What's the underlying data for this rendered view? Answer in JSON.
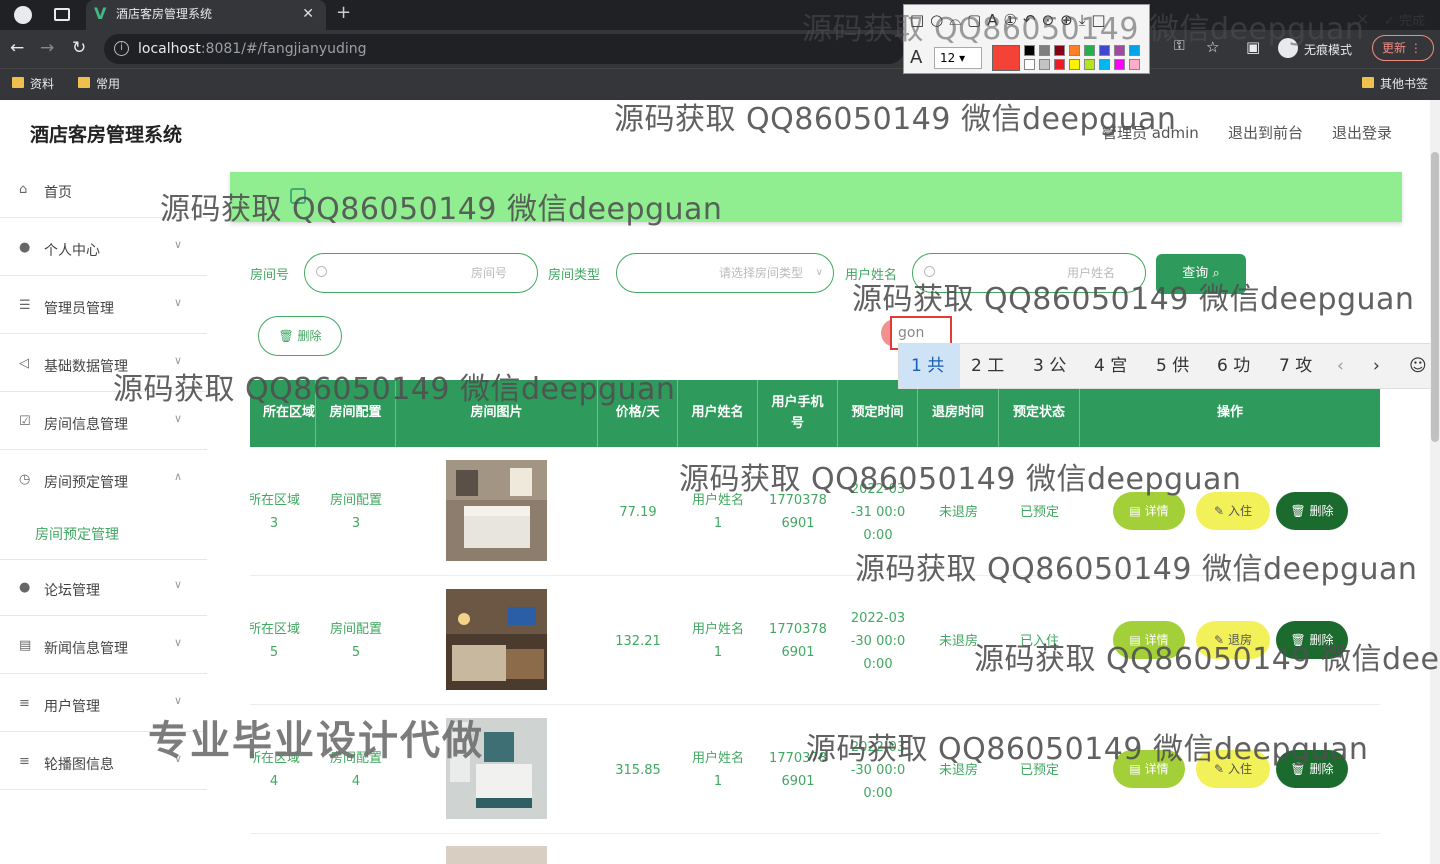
{
  "browser": {
    "tab_title": "酒店客房管理系统",
    "url_host": "localhost",
    "url_path": ":8081/#/fangjianyuding",
    "incognito_label": "无痕模式",
    "update_label": "更新",
    "bookmarks": [
      "资料",
      "常用"
    ],
    "other_bookmarks": "其他书签",
    "done_label": "完成"
  },
  "annotation_toolbar": {
    "tool_glyphs": "□○⌓▢A①↶⊙⊕⤓□",
    "font_size": "12",
    "current_color": "#f44336",
    "swatches": [
      "#000000",
      "#7f7f7f",
      "#880015",
      "#ff7f27",
      "#22b14c",
      "#3f48cc",
      "#a349a4",
      "#00a2e8",
      "#ffffff",
      "#c3c3c3",
      "#ed1c24",
      "#fff200",
      "#b5e61d",
      "#00b7ef",
      "#ff00ff",
      "#ffaec9"
    ]
  },
  "header": {
    "title": "酒店客房管理系统",
    "admin": "管理员 admin",
    "back_front": "退出到前台",
    "logout": "退出登录"
  },
  "sidebar": {
    "items": [
      "首页",
      "个人中心",
      "管理员管理",
      "基础数据管理",
      "房间信息管理",
      "房间预定管理",
      "论坛管理",
      "新闻信息管理",
      "用户管理",
      "轮播图信息"
    ],
    "sub_item": "房间预定管理"
  },
  "filters": {
    "room_no_label": "房间号",
    "room_no_placeholder": "房间号",
    "room_type_label": "房间类型",
    "room_type_placeholder": "请选择房间类型",
    "user_name_label": "用户姓名",
    "user_name_placeholder": "用户姓名",
    "query_button": "查询",
    "delete_button": "删除"
  },
  "ime": {
    "input": "gon",
    "candidates": [
      "1 共",
      "2 工",
      "3 公",
      "4 宫",
      "5 供",
      "6 功",
      "7 攻"
    ]
  },
  "table": {
    "headers": [
      "所在区域",
      "房间配置",
      "房间图片",
      "价格/天",
      "用户姓名",
      "用户手机号",
      "预定时间",
      "退房时间",
      "预定状态",
      "操作"
    ],
    "rows": [
      {
        "area": "所在区域\n3",
        "config": "房间配置\n3",
        "price": "77.19",
        "user": "用户姓名\n1",
        "phone": "1770378\n6901",
        "time": "2022-03\n-31 00:0\n0:00",
        "checkout": "未退房",
        "status": "已预定"
      },
      {
        "area": "所在区域\n5",
        "config": "房间配置\n5",
        "price": "132.21",
        "user": "用户姓名\n1",
        "phone": "1770378\n6901",
        "time": "2022-03\n-30 00:0\n0:00",
        "checkout": "未退房",
        "status": "已入住"
      },
      {
        "area": "所在区域\n4",
        "config": "房间配置\n4",
        "price": "315.85",
        "user": "用户姓名\n1",
        "phone": "1770378\n6901",
        "time": "2022-03\n-30 00:0\n0:00",
        "checkout": "未退房",
        "status": "已预定"
      }
    ],
    "action_detail": "详情",
    "action_checkin": "入住",
    "action_checkout": "退房",
    "action_delete": "删除"
  },
  "watermarks": {
    "text": "源码获取 QQ86050149 微信deepguan",
    "big": "专业毕业设计代做"
  }
}
